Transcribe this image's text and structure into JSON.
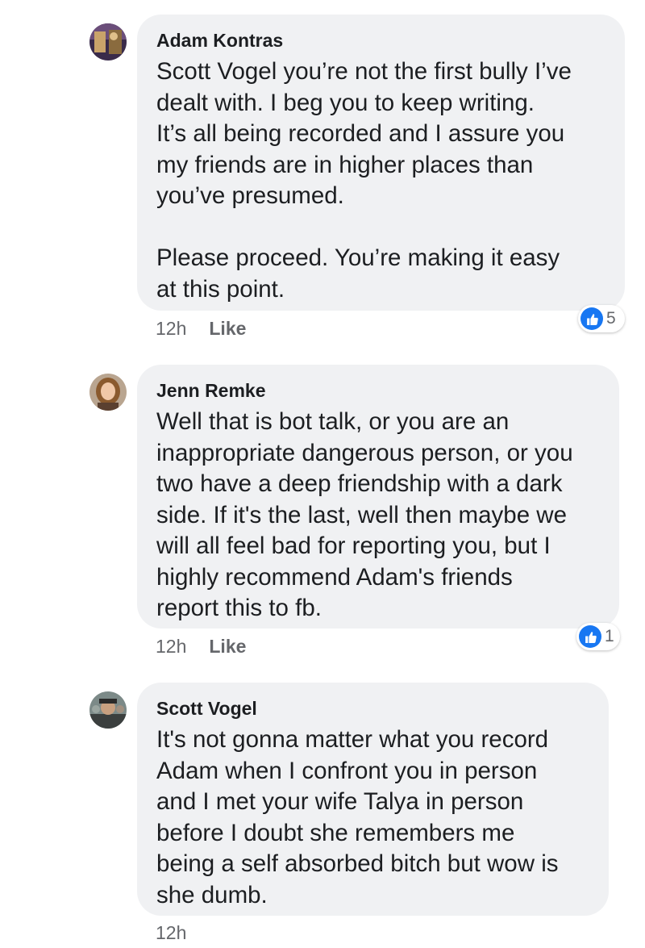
{
  "comments": [
    {
      "author": "Adam Kontras",
      "text": "Scott Vogel you’re not the first bully I’ve\ndealt with.  I beg you to keep writing.\nIt’s all being recorded and I assure you\nmy friends are in higher places than\nyou’ve presumed.\n\nPlease proceed.  You’re making it easy\nat this point.",
      "time": "12h",
      "like_label": "Like",
      "reaction_count": "5",
      "reaction_icon": "thumbs-up-icon"
    },
    {
      "author": "Jenn Remke",
      "text": "Well that is bot talk, or you are  an\ninappropriate dangerous person, or you\ntwo have a deep friendship with a dark\nside. If it's the last, well then maybe we\nwill all feel bad for reporting you, but I\nhighly recommend Adam's friends\nreport this to fb.",
      "time": "12h",
      "like_label": "Like",
      "reaction_count": "1",
      "reaction_icon": "thumbs-up-icon"
    },
    {
      "author": "Scott Vogel",
      "text": "It's not gonna matter what you record\nAdam when I confront you in person\nand I met your wife Talya in person\nbefore I doubt she remembers me\nbeing a self absorbed bitch but wow is\nshe dumb.",
      "time": "12h"
    }
  ],
  "colors": {
    "bubble": "#f0f1f3",
    "like_blue": "#1877f2",
    "meta_text": "#65676b"
  }
}
